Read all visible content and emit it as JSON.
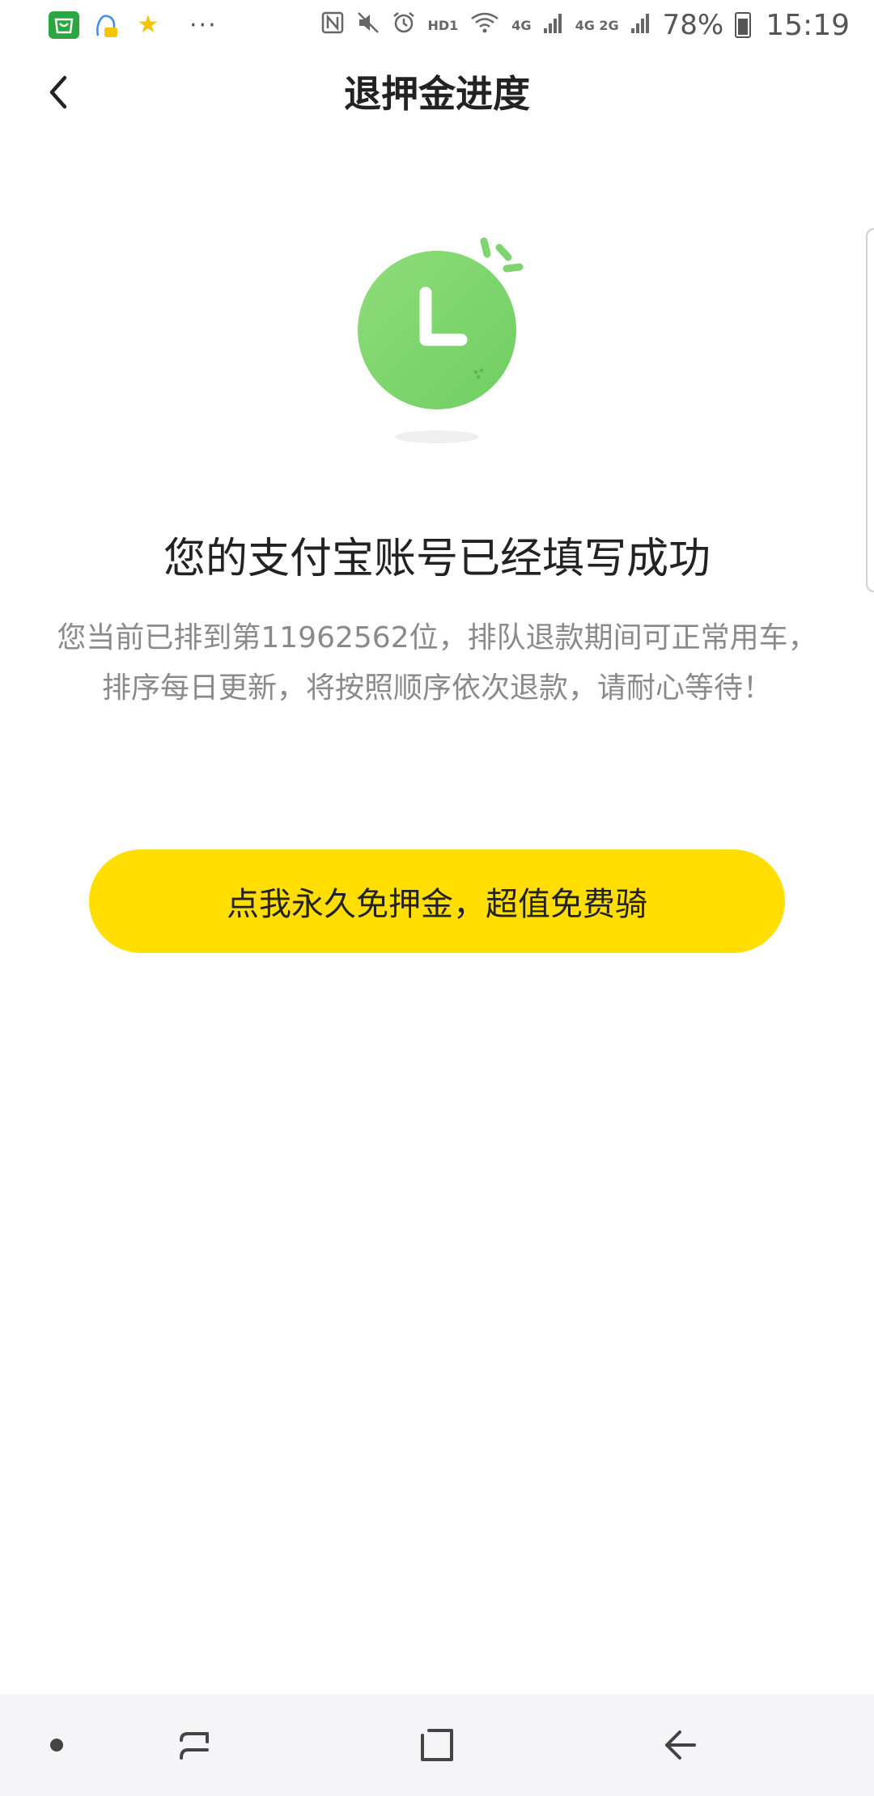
{
  "status_bar": {
    "battery_percent": "78%",
    "time": "15:19",
    "hd_label": "HD1",
    "network_4g_label": "4G",
    "network_4g2g_label": "4G 2G",
    "icons": [
      "app-store-icon",
      "qq-icon",
      "star-icon",
      "more-dots-icon",
      "nfc-icon",
      "mute-icon",
      "alarm-icon",
      "wifi-icon",
      "signal-icon",
      "battery-icon"
    ]
  },
  "header": {
    "title": "退押金进度",
    "back_icon": "chevron-left-icon"
  },
  "illustration": {
    "icon": "clock-icon",
    "color": "#7ed56f"
  },
  "main": {
    "success_title": "您的支付宝账号已经填写成功",
    "description": "您当前已排到第11962562位，排队退款期间可正常用车，排序每日更新，将按照顺序依次退款，请耐心等待！",
    "cta_label": "点我永久免押金，超值免费骑"
  },
  "colors": {
    "accent_yellow": "#ffde00",
    "clock_green": "#7ed56f",
    "text_gray": "#8a8a8a"
  },
  "nav_bar": {
    "icons": [
      "dot-icon",
      "recent-apps-icon",
      "home-icon",
      "back-icon"
    ]
  }
}
